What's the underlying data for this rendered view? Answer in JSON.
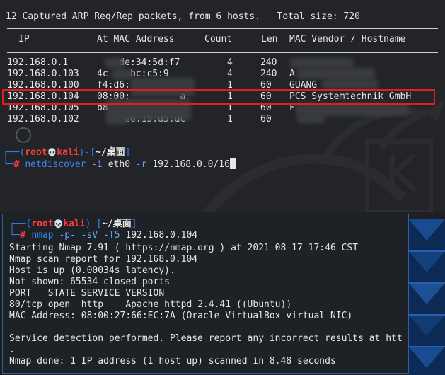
{
  "netdiscover": {
    "summary": "12 Captured ARP Req/Rep packets, from 6 hosts.   Total size: 720",
    "headers": {
      "ip": "IP",
      "mac": "At MAC Address",
      "count": "Count",
      "len": "Len",
      "vendor": "MAC Vendor / Hostname"
    },
    "rows": [
      {
        "ip": "192.168.0.1",
        "mac": "    de:34:5d:f7",
        "count": "4",
        "len": "240",
        "vendor": ""
      },
      {
        "ip": "192.168.0.103",
        "mac": "4c    bc:c5:9",
        "count": "4",
        "len": "240",
        "vendor": "A"
      },
      {
        "ip": "192.168.0.100",
        "mac": "f4:d6:",
        "count": "1",
        "len": "60",
        "vendor": "GUANG"
      },
      {
        "ip": "192.168.0.104",
        "mac": "08:00:         a",
        "count": "1",
        "len": "60",
        "vendor": "PCS Systemtechnik GmbH"
      },
      {
        "ip": "192.168.0.105",
        "mac": "b8",
        "count": "1",
        "len": "60",
        "vendor": "F"
      },
      {
        "ip": "192.168.0.102",
        "mac": "    :e6:15:d5:dc",
        "count": "1",
        "len": "60",
        "vendor": ""
      }
    ],
    "prompt": {
      "user": "root",
      "host": "kali",
      "dir": "~/桌面"
    },
    "command": {
      "name": "netdiscover",
      "flag1": "-i",
      "arg1": "eth0",
      "flag2": "-r",
      "arg2": "192.168.0.0/16"
    }
  },
  "nmap": {
    "prompt": {
      "user": "root",
      "host": "kali",
      "dir": "~/桌面"
    },
    "command": {
      "name": "nmap",
      "flags": "-p- -sV -T5",
      "target": "192.168.0.104"
    },
    "output": [
      "Starting Nmap 7.91 ( https://nmap.org ) at 2021-08-17 17:46 CST",
      "Nmap scan report for 192.168.0.104",
      "Host is up (0.00034s latency).",
      "Not shown: 65534 closed ports",
      "PORT   STATE SERVICE VERSION",
      "80/tcp open  http    Apache httpd 2.4.41 ((Ubuntu))",
      "MAC Address: 08:00:27:66:EC:7A (Oracle VirtualBox virtual NIC)",
      "",
      "Service detection performed. Please report any incorrect results at htt",
      ".",
      "Nmap done: 1 IP address (1 host up) scanned in 8.48 seconds"
    ]
  },
  "colors": {
    "highlight": "#e11d24",
    "prompt_frame": "#2f7cf6",
    "root": "#ff3b3b",
    "command": "#3b88f8"
  }
}
